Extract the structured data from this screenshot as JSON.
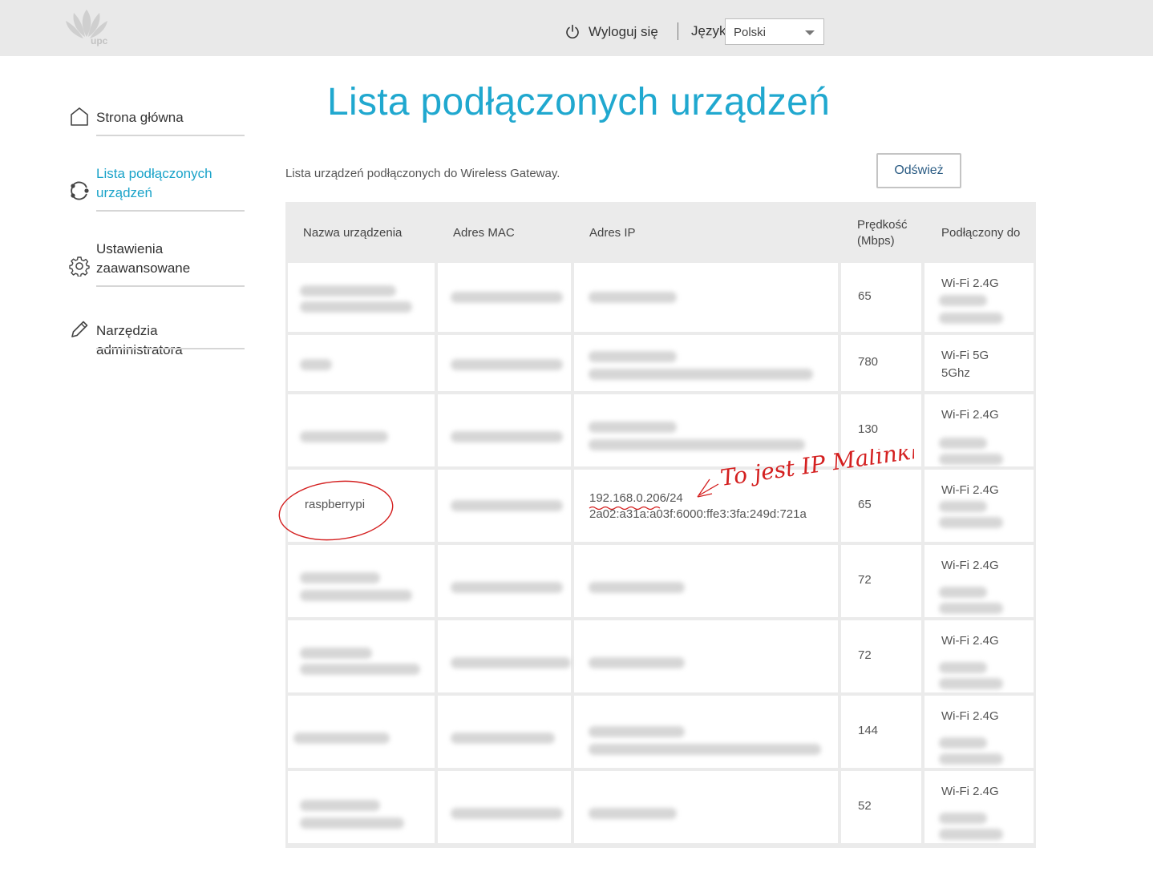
{
  "brand": {
    "logo_text": "upc"
  },
  "header": {
    "logout_label": "Wyloguj się",
    "language_label": "Język",
    "language_value": "Polski"
  },
  "sidebar": {
    "items": [
      {
        "label": "Strona główna",
        "icon": "home-icon"
      },
      {
        "label_lines": [
          "Lista podłączonych",
          "urządzeń"
        ],
        "icon": "devices-icon",
        "active": true
      },
      {
        "label_lines": [
          "Ustawienia",
          "zaawansowane"
        ],
        "icon": "gear-icon"
      },
      {
        "label": "Narzędzia administratora",
        "icon": "pencil-icon"
      }
    ]
  },
  "main": {
    "title": "Lista podłączonych urządzeń",
    "description": "Lista urządzeń podłączonych do Wireless Gateway.",
    "refresh_label": "Odśwież",
    "table": {
      "headers": [
        "Nazwa urządzenia",
        "Adres MAC",
        "Adres IP",
        "Prędkość",
        "(Mbps)",
        "Podłączony do"
      ],
      "rows": [
        {
          "speed": "65",
          "connected": "Wi-Fi 2.4G"
        },
        {
          "speed": "780",
          "connected": "Wi-Fi 5G",
          "connected2": "5Ghz"
        },
        {
          "speed": "130",
          "connected": "Wi-Fi 2.4G"
        },
        {
          "name": "raspberrypi",
          "ip1": "192.168.0.206/24",
          "ip2": "2a02:a31a:a03f:6000:ffe3:3fa:249d:721a",
          "speed": "65",
          "connected": "Wi-Fi 2.4G"
        },
        {
          "speed": "72",
          "connected": "Wi-Fi 2.4G"
        },
        {
          "speed": "72",
          "connected": "Wi-Fi 2.4G"
        },
        {
          "speed": "144",
          "connected": "Wi-Fi 2.4G"
        },
        {
          "speed": "52",
          "connected": "Wi-Fi 2.4G"
        }
      ]
    },
    "annotation": "To jest IP Malinki"
  },
  "colors": {
    "accent": "#1aa3c9",
    "annotation": "#d42020"
  }
}
